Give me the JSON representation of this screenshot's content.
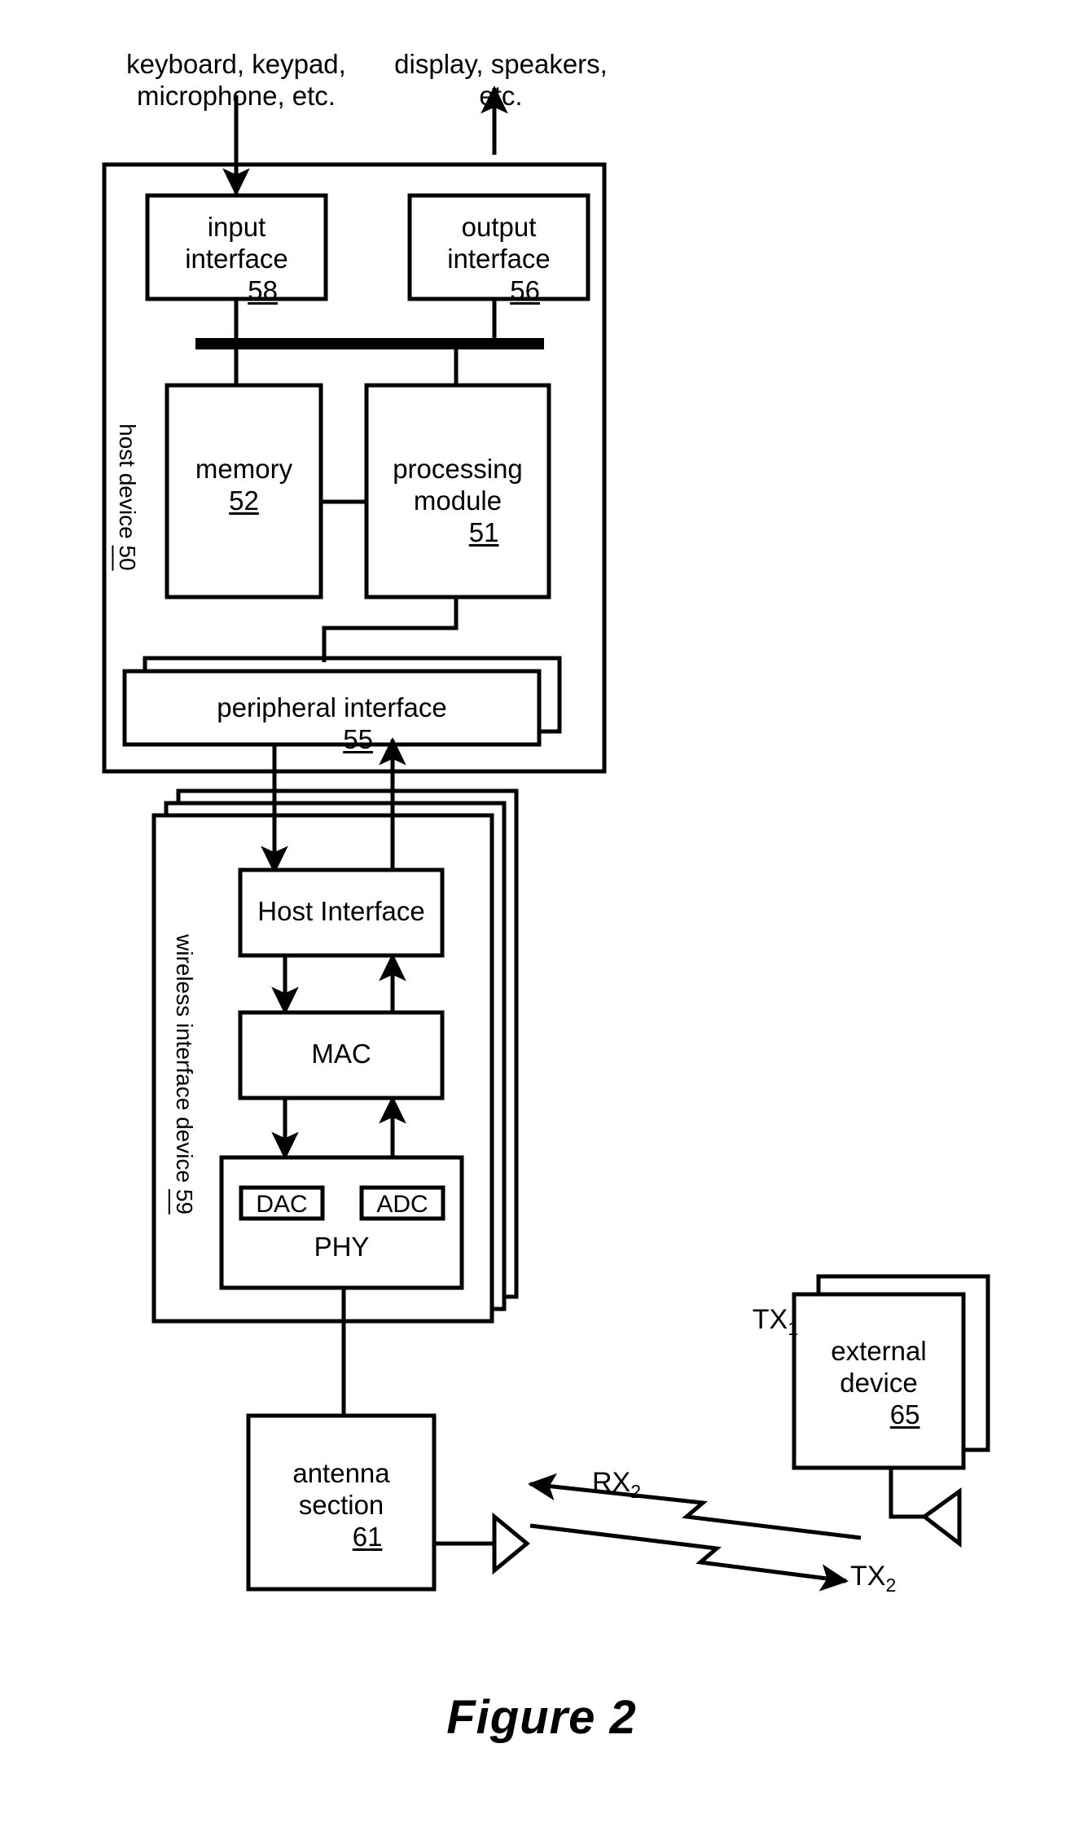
{
  "figure": {
    "caption": "Figure 2"
  },
  "annotations": {
    "input_sources": "keyboard, keypad,\nmicrophone, etc.",
    "output_sinks": "display, speakers,\netc."
  },
  "host_device": {
    "enclosure_label": "host device 50",
    "enclosure_label_text": "host device",
    "enclosure_label_ref": "50",
    "blocks": [
      {
        "id": "input-interface",
        "line1": "input",
        "line2": "interface",
        "ref": "58"
      },
      {
        "id": "output-interface",
        "line1": "output",
        "line2": "interface",
        "ref": "56"
      },
      {
        "id": "memory",
        "line1": "memory",
        "line2": "",
        "ref": "52"
      },
      {
        "id": "processing-module",
        "line1": "processing",
        "line2": "module",
        "ref": "51"
      },
      {
        "id": "peripheral-interface",
        "line1": "peripheral interface",
        "line2": "",
        "ref": "55"
      }
    ]
  },
  "wireless_interface_device": {
    "enclosure_label": "wireless interface device 59",
    "enclosure_label_text": "wireless interface device",
    "enclosure_label_ref": "59",
    "blocks": [
      {
        "id": "host-interface",
        "label": "Host Interface"
      },
      {
        "id": "mac",
        "label": "MAC"
      },
      {
        "id": "phy",
        "label": "PHY"
      },
      {
        "id": "dac",
        "label": "DAC"
      },
      {
        "id": "adc",
        "label": "ADC"
      }
    ]
  },
  "antenna_section": {
    "line1": "antenna",
    "line2": "section",
    "ref": "61"
  },
  "external_device": {
    "line1": "external",
    "line2": "device",
    "ref": "65"
  },
  "signals": {
    "tx1": "TX",
    "tx1_sub": "1",
    "tx2": "TX",
    "tx2_sub": "2",
    "rx2": "RX",
    "rx2_sub": "2"
  },
  "colors": {
    "ink": "#000000",
    "paper": "#ffffff"
  }
}
